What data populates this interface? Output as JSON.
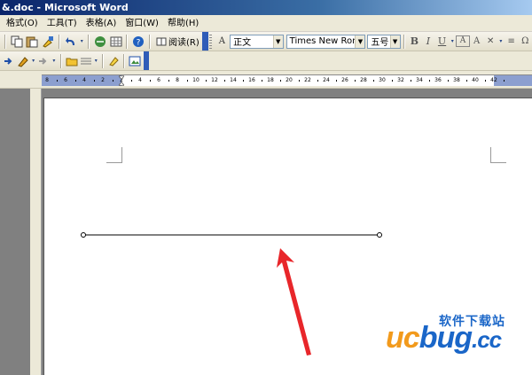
{
  "window": {
    "title": "&.doc - Microsoft Word"
  },
  "menu": {
    "items": [
      "格式(O)",
      "工具(T)",
      "表格(A)",
      "窗口(W)",
      "帮助(H)"
    ]
  },
  "toolbar": {
    "read_button": "阅读(R)",
    "style_value": "正文",
    "font_value": "Times New Roman",
    "size_value": "五号",
    "icons": [
      "copy-icon",
      "paste-icon",
      "format-painter-icon",
      "undo-icon",
      "hyperlink-icon",
      "table-icon",
      "help-icon",
      "bold-icon",
      "italic-icon",
      "underline-icon",
      "font-color-icon"
    ]
  },
  "ruler": {
    "labels": [
      "8",
      "6",
      "4",
      "2",
      "2",
      "4",
      "6",
      "8",
      "10",
      "12",
      "14",
      "16",
      "18",
      "20",
      "22",
      "24",
      "26",
      "28",
      "30",
      "32",
      "34",
      "36",
      "38",
      "40",
      "42"
    ]
  },
  "watermark": {
    "cn": "软件下载站",
    "uc": "uc",
    "bug": "bug",
    "cc": ".cc"
  },
  "colors": {
    "arrow": "#e8262a",
    "watermark_orange": "#f29a1c",
    "watermark_blue": "#1a66c8",
    "title_bar": "#0a246a"
  }
}
